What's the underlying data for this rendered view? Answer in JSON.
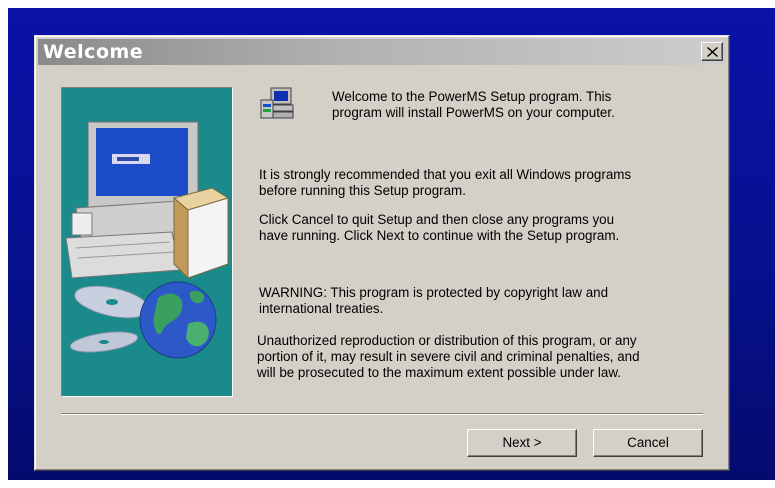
{
  "window": {
    "title": "Welcome",
    "close_icon": "close-icon"
  },
  "content": {
    "intro_line1": "Welcome to the PowerMS Setup program.  This",
    "intro_line2": "program will install PowerMS on your computer.",
    "recommend": "It is strongly recommended that you exit all Windows programs\nbefore running this Setup program.",
    "cancel_info": "Click Cancel to quit Setup and then close any programs you\nhave running.  Click Next to continue with the Setup program.",
    "warning": "WARNING: This program is protected by copyright law and\ninternational treaties.",
    "unauthorized": "Unauthorized reproduction or distribution of this program, or any\nportion of it, may result in severe civil and criminal penalties, and\nwill be prosecuted to the maximum extent possible under law."
  },
  "buttons": {
    "next": "Next >",
    "cancel": "Cancel"
  },
  "colors": {
    "desktop": "#07108e",
    "dialog": "#d4d0c8",
    "side_panel": "#1a8a8a"
  }
}
